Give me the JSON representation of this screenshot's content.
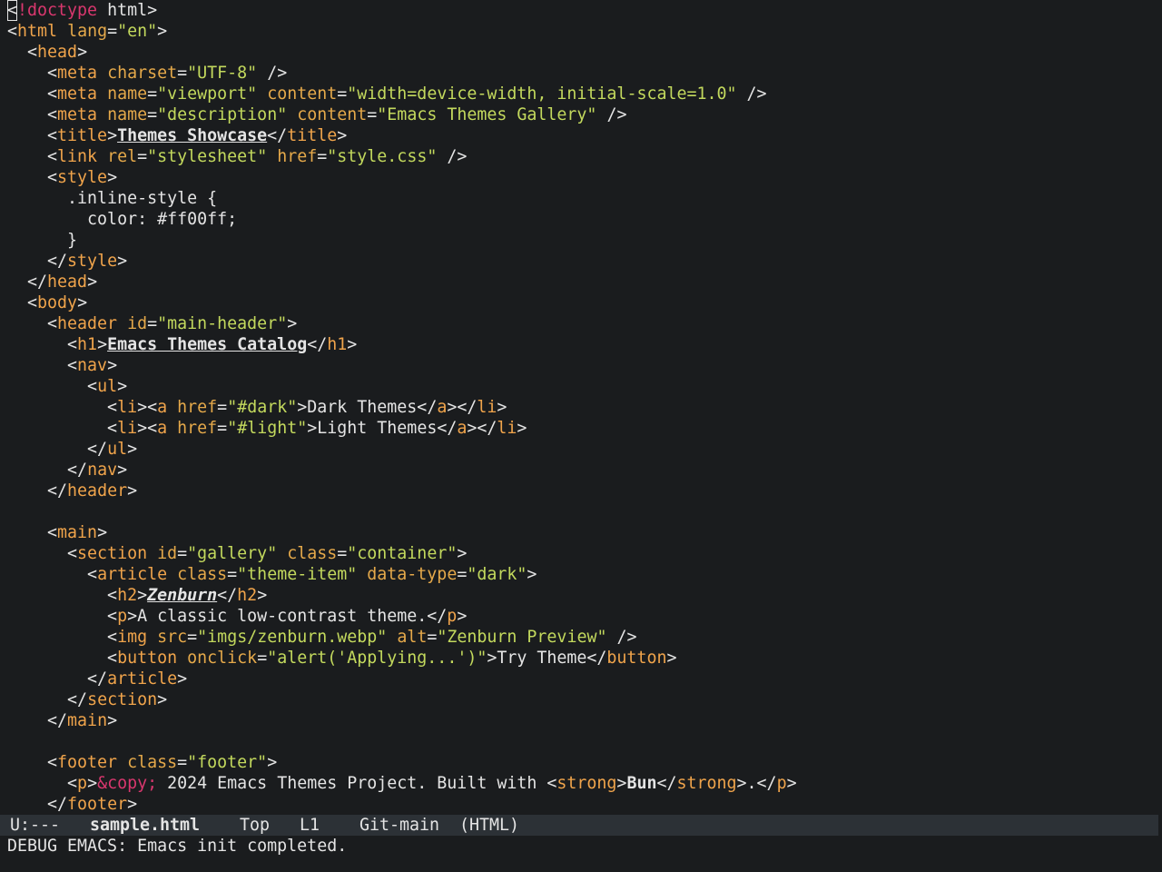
{
  "theme": {
    "background": "#1a1c1e",
    "foreground": "#e4e4e4",
    "keyword": "#d9376e",
    "tag": "#f0a44b",
    "attribute": "#e5a94a",
    "string": "#c3d95d",
    "modeline_bg": "#2c3136"
  },
  "editor": {
    "lines": [
      [
        [
          "cursor",
          "<"
        ],
        [
          "kw",
          "!doctype"
        ],
        [
          "t",
          " html>"
        ]
      ],
      [
        [
          "t",
          "<"
        ],
        [
          "tag",
          "html"
        ],
        [
          "t",
          " "
        ],
        [
          "attr",
          "lang"
        ],
        [
          "t",
          "="
        ],
        [
          "str",
          "\"en\""
        ],
        [
          "t",
          ">"
        ]
      ],
      [
        [
          "t",
          "  <"
        ],
        [
          "tag",
          "head"
        ],
        [
          "t",
          ">"
        ]
      ],
      [
        [
          "t",
          "    <"
        ],
        [
          "tag",
          "meta"
        ],
        [
          "t",
          " "
        ],
        [
          "attr",
          "charset"
        ],
        [
          "t",
          "="
        ],
        [
          "str",
          "\"UTF-8\""
        ],
        [
          "t",
          " />"
        ]
      ],
      [
        [
          "t",
          "    <"
        ],
        [
          "tag",
          "meta"
        ],
        [
          "t",
          " "
        ],
        [
          "attr",
          "name"
        ],
        [
          "t",
          "="
        ],
        [
          "str",
          "\"viewport\""
        ],
        [
          "t",
          " "
        ],
        [
          "attr",
          "content"
        ],
        [
          "t",
          "="
        ],
        [
          "str",
          "\"width=device-width, initial-scale=1.0\""
        ],
        [
          "t",
          " />"
        ]
      ],
      [
        [
          "t",
          "    <"
        ],
        [
          "tag",
          "meta"
        ],
        [
          "t",
          " "
        ],
        [
          "attr",
          "name"
        ],
        [
          "t",
          "="
        ],
        [
          "str",
          "\"description\""
        ],
        [
          "t",
          " "
        ],
        [
          "attr",
          "content"
        ],
        [
          "t",
          "="
        ],
        [
          "str",
          "\"Emacs Themes Gallery\""
        ],
        [
          "t",
          " />"
        ]
      ],
      [
        [
          "t",
          "    <"
        ],
        [
          "tag",
          "title"
        ],
        [
          "t",
          ">"
        ],
        [
          "bu",
          "Themes Showcase"
        ],
        [
          "t",
          "</"
        ],
        [
          "tag",
          "title"
        ],
        [
          "t",
          ">"
        ]
      ],
      [
        [
          "t",
          "    <"
        ],
        [
          "tag",
          "link"
        ],
        [
          "t",
          " "
        ],
        [
          "attr",
          "rel"
        ],
        [
          "t",
          "="
        ],
        [
          "str",
          "\"stylesheet\""
        ],
        [
          "t",
          " "
        ],
        [
          "attr",
          "href"
        ],
        [
          "t",
          "="
        ],
        [
          "str",
          "\"style.css\""
        ],
        [
          "t",
          " />"
        ]
      ],
      [
        [
          "t",
          "    <"
        ],
        [
          "tag",
          "style"
        ],
        [
          "t",
          ">"
        ]
      ],
      [
        [
          "t",
          "      .inline-style {"
        ]
      ],
      [
        [
          "t",
          "        color: #ff00ff;"
        ]
      ],
      [
        [
          "t",
          "      }"
        ]
      ],
      [
        [
          "t",
          "    </"
        ],
        [
          "tag",
          "style"
        ],
        [
          "t",
          ">"
        ]
      ],
      [
        [
          "t",
          "  </"
        ],
        [
          "tag",
          "head"
        ],
        [
          "t",
          ">"
        ]
      ],
      [
        [
          "t",
          "  <"
        ],
        [
          "tag",
          "body"
        ],
        [
          "t",
          ">"
        ]
      ],
      [
        [
          "t",
          "    <"
        ],
        [
          "tag",
          "header"
        ],
        [
          "t",
          " "
        ],
        [
          "attr",
          "id"
        ],
        [
          "t",
          "="
        ],
        [
          "str",
          "\"main-header\""
        ],
        [
          "t",
          ">"
        ]
      ],
      [
        [
          "t",
          "      <"
        ],
        [
          "tag",
          "h1"
        ],
        [
          "t",
          ">"
        ],
        [
          "bu",
          "Emacs Themes Catalog"
        ],
        [
          "t",
          "</"
        ],
        [
          "tag",
          "h1"
        ],
        [
          "t",
          ">"
        ]
      ],
      [
        [
          "t",
          "      <"
        ],
        [
          "tag",
          "nav"
        ],
        [
          "t",
          ">"
        ]
      ],
      [
        [
          "t",
          "        <"
        ],
        [
          "tag",
          "ul"
        ],
        [
          "t",
          ">"
        ]
      ],
      [
        [
          "t",
          "          <"
        ],
        [
          "tag",
          "li"
        ],
        [
          "t",
          "><"
        ],
        [
          "tag",
          "a"
        ],
        [
          "t",
          " "
        ],
        [
          "attr",
          "href"
        ],
        [
          "t",
          "="
        ],
        [
          "str",
          "\"#dark\""
        ],
        [
          "t",
          ">Dark Themes</"
        ],
        [
          "tag",
          "a"
        ],
        [
          "t",
          "></"
        ],
        [
          "tag",
          "li"
        ],
        [
          "t",
          ">"
        ]
      ],
      [
        [
          "t",
          "          <"
        ],
        [
          "tag",
          "li"
        ],
        [
          "t",
          "><"
        ],
        [
          "tag",
          "a"
        ],
        [
          "t",
          " "
        ],
        [
          "attr",
          "href"
        ],
        [
          "t",
          "="
        ],
        [
          "str",
          "\"#light\""
        ],
        [
          "t",
          ">Light Themes</"
        ],
        [
          "tag",
          "a"
        ],
        [
          "t",
          "></"
        ],
        [
          "tag",
          "li"
        ],
        [
          "t",
          ">"
        ]
      ],
      [
        [
          "t",
          "        </"
        ],
        [
          "tag",
          "ul"
        ],
        [
          "t",
          ">"
        ]
      ],
      [
        [
          "t",
          "      </"
        ],
        [
          "tag",
          "nav"
        ],
        [
          "t",
          ">"
        ]
      ],
      [
        [
          "t",
          "    </"
        ],
        [
          "tag",
          "header"
        ],
        [
          "t",
          ">"
        ]
      ],
      [],
      [
        [
          "t",
          "    <"
        ],
        [
          "tag",
          "main"
        ],
        [
          "t",
          ">"
        ]
      ],
      [
        [
          "t",
          "      <"
        ],
        [
          "tag",
          "section"
        ],
        [
          "t",
          " "
        ],
        [
          "attr",
          "id"
        ],
        [
          "t",
          "="
        ],
        [
          "str",
          "\"gallery\""
        ],
        [
          "t",
          " "
        ],
        [
          "attr",
          "class"
        ],
        [
          "t",
          "="
        ],
        [
          "str",
          "\"container\""
        ],
        [
          "t",
          ">"
        ]
      ],
      [
        [
          "t",
          "        <"
        ],
        [
          "tag",
          "article"
        ],
        [
          "t",
          " "
        ],
        [
          "attr",
          "class"
        ],
        [
          "t",
          "="
        ],
        [
          "str",
          "\"theme-item\""
        ],
        [
          "t",
          " "
        ],
        [
          "attr",
          "data-type"
        ],
        [
          "t",
          "="
        ],
        [
          "str",
          "\"dark\""
        ],
        [
          "t",
          ">"
        ]
      ],
      [
        [
          "t",
          "          <"
        ],
        [
          "tag",
          "h2"
        ],
        [
          "t",
          ">"
        ],
        [
          "biu",
          "Zenburn"
        ],
        [
          "t",
          "</"
        ],
        [
          "tag",
          "h2"
        ],
        [
          "t",
          ">"
        ]
      ],
      [
        [
          "t",
          "          <"
        ],
        [
          "tag",
          "p"
        ],
        [
          "t",
          ">A classic low-contrast theme.</"
        ],
        [
          "tag",
          "p"
        ],
        [
          "t",
          ">"
        ]
      ],
      [
        [
          "t",
          "          <"
        ],
        [
          "tag",
          "img"
        ],
        [
          "t",
          " "
        ],
        [
          "attr",
          "src"
        ],
        [
          "t",
          "="
        ],
        [
          "str",
          "\"imgs/zenburn.webp\""
        ],
        [
          "t",
          " "
        ],
        [
          "attr",
          "alt"
        ],
        [
          "t",
          "="
        ],
        [
          "str",
          "\"Zenburn Preview\""
        ],
        [
          "t",
          " />"
        ]
      ],
      [
        [
          "t",
          "          <"
        ],
        [
          "tag",
          "button"
        ],
        [
          "t",
          " "
        ],
        [
          "attr",
          "onclick"
        ],
        [
          "t",
          "="
        ],
        [
          "str",
          "\"alert('Applying...')\""
        ],
        [
          "t",
          ">Try Theme</"
        ],
        [
          "tag",
          "button"
        ],
        [
          "t",
          ">"
        ]
      ],
      [
        [
          "t",
          "        </"
        ],
        [
          "tag",
          "article"
        ],
        [
          "t",
          ">"
        ]
      ],
      [
        [
          "t",
          "      </"
        ],
        [
          "tag",
          "section"
        ],
        [
          "t",
          ">"
        ]
      ],
      [
        [
          "t",
          "    </"
        ],
        [
          "tag",
          "main"
        ],
        [
          "t",
          ">"
        ]
      ],
      [],
      [
        [
          "t",
          "    <"
        ],
        [
          "tag",
          "footer"
        ],
        [
          "t",
          " "
        ],
        [
          "attr",
          "class"
        ],
        [
          "t",
          "="
        ],
        [
          "str",
          "\"footer\""
        ],
        [
          "t",
          ">"
        ]
      ],
      [
        [
          "t",
          "      <"
        ],
        [
          "tag",
          "p"
        ],
        [
          "t",
          ">"
        ],
        [
          "kw",
          "&copy;"
        ],
        [
          "t",
          " 2024 Emacs Themes Project. Built with <"
        ],
        [
          "tag",
          "strong"
        ],
        [
          "t",
          ">"
        ],
        [
          "b",
          "Bun"
        ],
        [
          "t",
          "</"
        ],
        [
          "tag",
          "strong"
        ],
        [
          "t",
          ">.</"
        ],
        [
          "tag",
          "p"
        ],
        [
          "t",
          ">"
        ]
      ],
      [
        [
          "t",
          "    </"
        ],
        [
          "tag",
          "footer"
        ],
        [
          "t",
          ">"
        ]
      ]
    ]
  },
  "modeline": {
    "status": "U:---",
    "buffer_name": "sample.html",
    "position": "Top",
    "line": "L1",
    "vc": "Git-main",
    "mode": "(HTML)"
  },
  "minibuffer": {
    "message": "DEBUG EMACS: Emacs init completed."
  }
}
